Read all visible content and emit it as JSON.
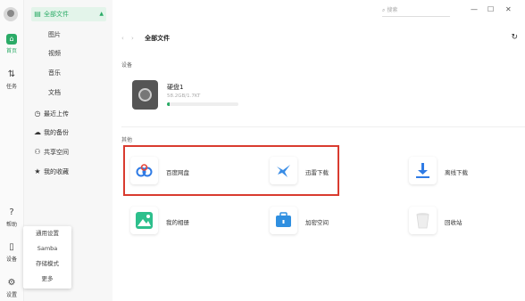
{
  "rail": {
    "items": [
      {
        "label": "首页"
      },
      {
        "label": "任务"
      },
      {
        "label": "帮助"
      },
      {
        "label": "设备"
      },
      {
        "label": "设置"
      }
    ]
  },
  "sidebar": {
    "all_files": "全部文件",
    "sub_items": [
      "图片",
      "视频",
      "音乐",
      "文档"
    ],
    "items": [
      "最近上传",
      "我的备份",
      "共享空间",
      "我的收藏"
    ]
  },
  "popup": {
    "items": [
      "通用设置",
      "Samba",
      "存储模式",
      "更多"
    ]
  },
  "search": {
    "placeholder": "搜索"
  },
  "main": {
    "title": "全部文件",
    "devices_label": "设备",
    "disk": {
      "name": "硬盘1",
      "size": "58.2GB/1.7KT",
      "used_fraction": 0.04
    },
    "other_label": "其他",
    "apps": [
      {
        "label": "百度网盘",
        "icon": "baidu-netdisk-icon"
      },
      {
        "label": "迅雷下载",
        "icon": "xunlei-icon"
      },
      {
        "label": "离线下载",
        "icon": "download-icon"
      },
      {
        "label": "我的相册",
        "icon": "photo-album-icon"
      },
      {
        "label": "加密空间",
        "icon": "encrypted-space-icon"
      },
      {
        "label": "回收站",
        "icon": "recycle-bin-icon"
      }
    ]
  },
  "colors": {
    "accent": "#2bab67",
    "highlight": "#d93b2f"
  }
}
